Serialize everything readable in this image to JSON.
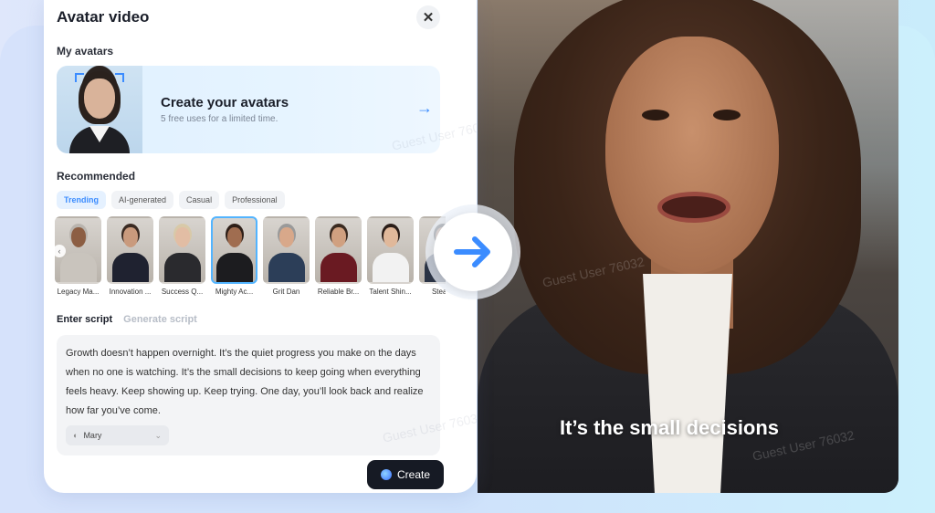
{
  "panel": {
    "title": "Avatar video",
    "my_avatars_label": "My avatars",
    "create_card": {
      "title": "Create your avatars",
      "subtitle": "5 free uses for a limited time."
    },
    "recommended_label": "Recommended",
    "tabs": [
      "Trending",
      "AI-generated",
      "Casual",
      "Professional"
    ],
    "active_tab": "Trending",
    "avatars": [
      {
        "name": "Legacy Ma...",
        "hair": "#b9b4ae",
        "skin": "#8c5e43",
        "body": "#c9c4bd"
      },
      {
        "name": "Innovation ...",
        "hair": "#3a2a22",
        "skin": "#c99a7d",
        "body": "#1f2230"
      },
      {
        "name": "Success Q...",
        "hair": "#d8c9a8",
        "skin": "#e2bda4",
        "body": "#2a2a2e"
      },
      {
        "name": "Mighty Ac...",
        "hair": "#2e1f18",
        "skin": "#a06d50",
        "body": "#1c1c1f"
      },
      {
        "name": "Grit Dan",
        "hair": "#9a9a9a",
        "skin": "#d8a88a",
        "body": "#2c3e58"
      },
      {
        "name": "Reliable Br...",
        "hair": "#3a2a20",
        "skin": "#d0a080",
        "body": "#6a1a22"
      },
      {
        "name": "Talent Shin...",
        "hair": "#2a1d18",
        "skin": "#e0b89a",
        "body": "#f2f2f2"
      },
      {
        "name": "Stea...",
        "hair": "#2a2a2a",
        "skin": "#b58468",
        "body": "#2a3344"
      }
    ],
    "selected_avatar_index": 3,
    "script_tabs": [
      "Enter script",
      "Generate script"
    ],
    "script_text": "Growth doesn’t happen overnight. It’s the quiet progress you make on the days when no one is watching. It’s the small decisions to keep going when everything feels heavy. Keep showing up. Keep trying. One day, you’ll look back and realize how far you’ve come.",
    "voice": "Mary",
    "create_button": "Create"
  },
  "video": {
    "caption": "It’s the small decisions"
  },
  "watermark": "Guest User 76032",
  "colors": {
    "accent": "#3b8cff",
    "dark_button": "#161a24"
  },
  "icons": {
    "close": "close-icon",
    "arrow": "arrow-right-icon",
    "voice": "voice-icon",
    "chevron": "chevron-down-icon"
  }
}
